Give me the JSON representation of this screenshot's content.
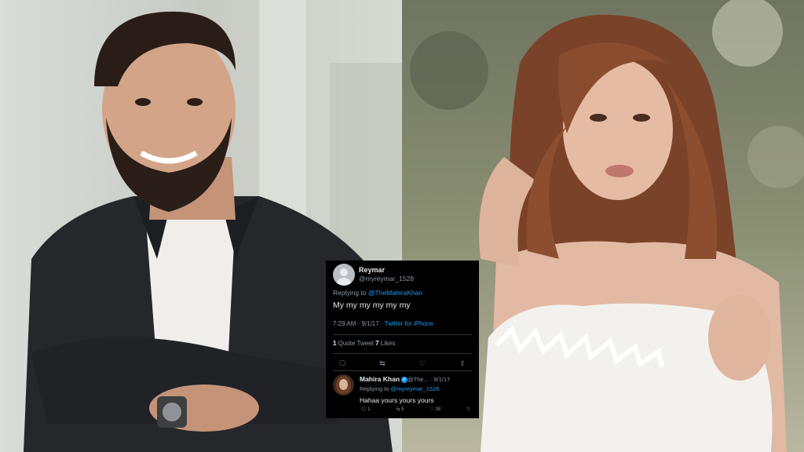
{
  "tweet": {
    "author_name": "Reymar",
    "author_handle": "@myreymar_1528",
    "replying_prefix": "Replying to ",
    "replying_to": "@TheMahiraKhan",
    "text": "My my my my my my",
    "time_date": "7:29 AM · 9/1/17 · ",
    "source": "Twitter for iPhone",
    "quote_count": "1",
    "quote_label": " Quote Tweet  ",
    "likes_count": "7",
    "likes_label": " Likes"
  },
  "reply": {
    "author_name": "Mahira Khan",
    "author_handle": "@The... · 9/1/17",
    "replying_prefix": "Replying to ",
    "replying_to": "@myreymar_1528",
    "text": "Hahaa yours yours yours",
    "reply_count": "1",
    "retweet_count": "5",
    "like_count": "38"
  },
  "icons": [
    "reply-icon",
    "retweet-icon",
    "like-icon",
    "share-icon",
    "verified-icon"
  ],
  "colors": {
    "link": "#1d9bf0",
    "background": "#000000",
    "muted": "#8b98a5"
  }
}
